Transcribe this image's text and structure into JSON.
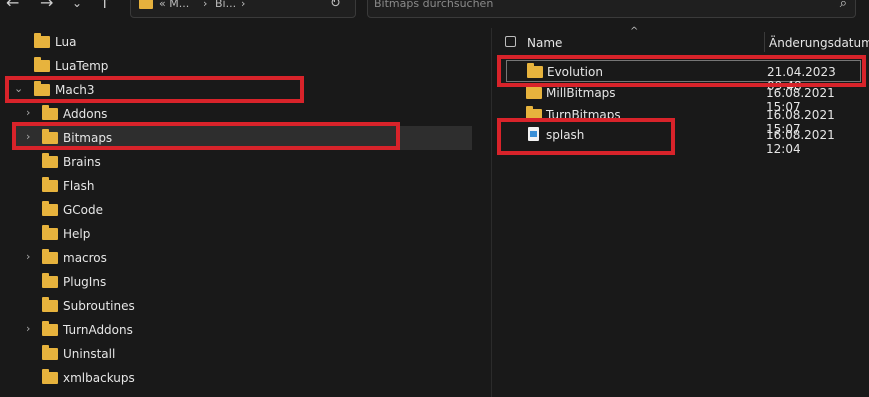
{
  "toolbar": {
    "back_icon": "←",
    "forward_icon": "→",
    "recent_icon": "⌄",
    "up_icon": "↑",
    "address_part1": "« M...",
    "address_sep": "›",
    "address_part2": "Bi...",
    "address_sep2": "›",
    "refresh_icon": "↻",
    "search_placeholder": "Bitmaps durchsuchen",
    "search_icon": "⌕"
  },
  "tree": [
    {
      "label": "Lua",
      "chevron": ""
    },
    {
      "label": "LuaTemp",
      "chevron": ""
    },
    {
      "label": "Mach3",
      "chevron": "⌄"
    },
    {
      "label": "Addons",
      "chevron": "›"
    },
    {
      "label": "Bitmaps",
      "chevron": "›"
    },
    {
      "label": "Brains",
      "chevron": ""
    },
    {
      "label": "Flash",
      "chevron": ""
    },
    {
      "label": "GCode",
      "chevron": ""
    },
    {
      "label": "Help",
      "chevron": ""
    },
    {
      "label": "macros",
      "chevron": "›"
    },
    {
      "label": "PlugIns",
      "chevron": ""
    },
    {
      "label": "Subroutines",
      "chevron": ""
    },
    {
      "label": "TurnAddons",
      "chevron": "›"
    },
    {
      "label": "Uninstall",
      "chevron": ""
    },
    {
      "label": "xmlbackups",
      "chevron": ""
    }
  ],
  "columns": {
    "name": "Name",
    "date": "Änderungsdatum",
    "sort_icon": "^"
  },
  "files": [
    {
      "name": "Evolution",
      "date": "21.04.2023 09:48",
      "type": "folder"
    },
    {
      "name": "MillBitmaps",
      "date": "16.08.2021 15:07",
      "type": "folder"
    },
    {
      "name": "TurnBitmaps",
      "date": "16.08.2021 15:07",
      "type": "folder"
    },
    {
      "name": "splash",
      "date": "16.08.2021 12:04",
      "type": "file"
    }
  ],
  "colors": {
    "highlight": "#d8232a",
    "folder": "#e7b33d",
    "background": "#191919"
  }
}
